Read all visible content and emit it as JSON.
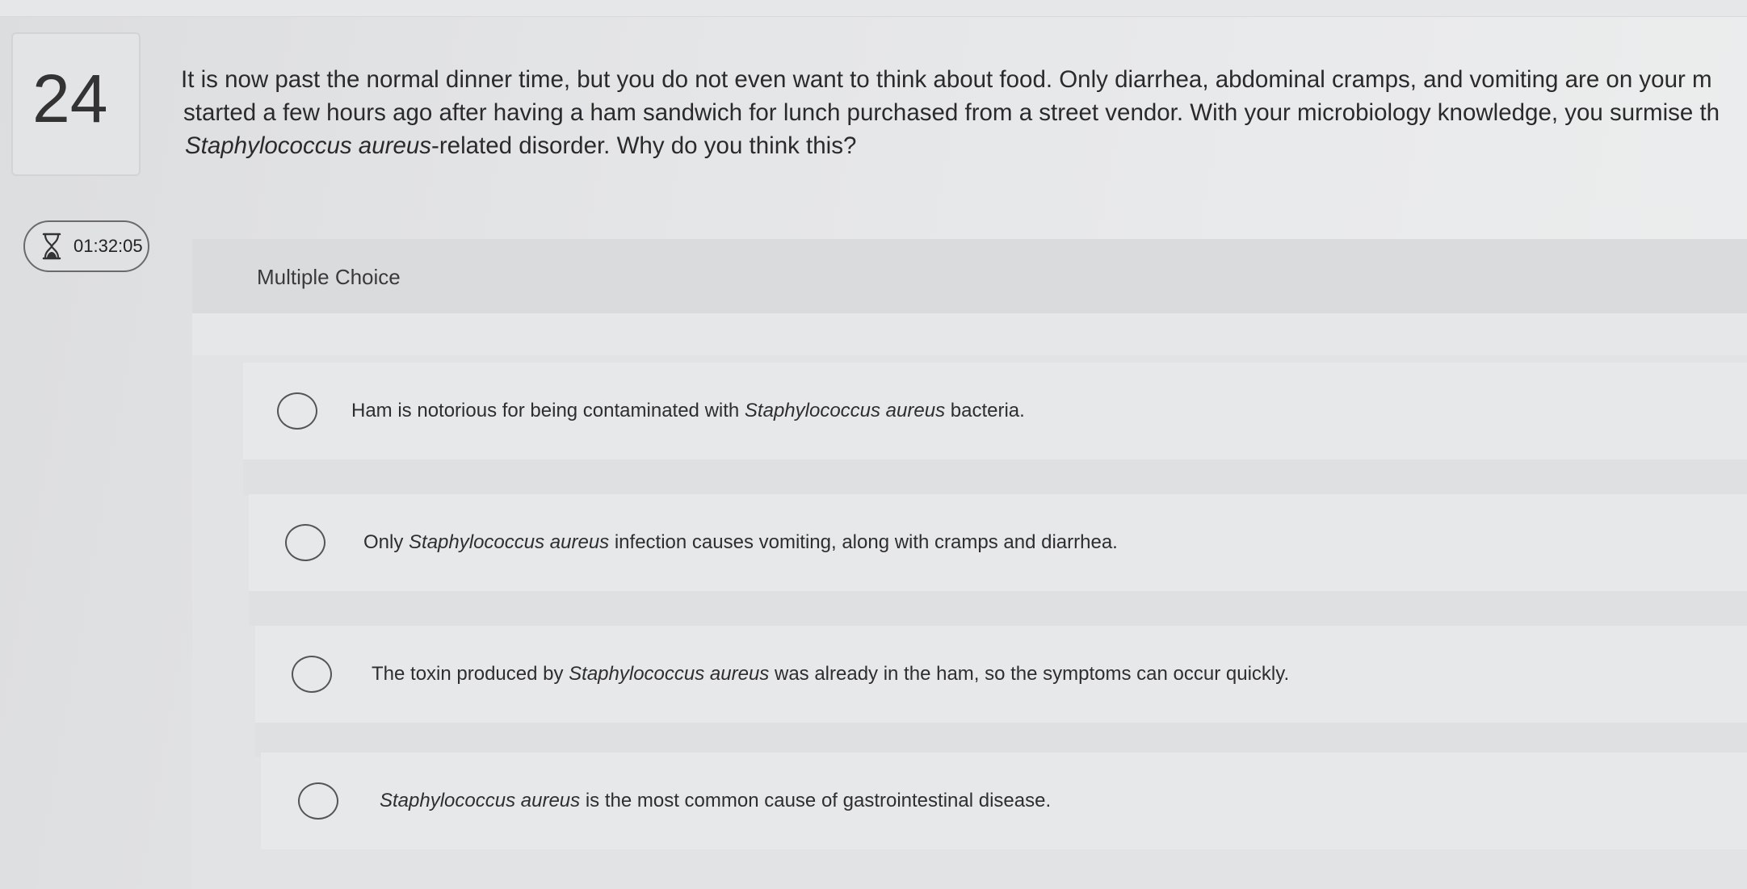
{
  "question": {
    "number": "24",
    "line1": "It is now past the normal dinner time, but you do not even want to think about food. Only diarrhea, abdominal cramps, and vomiting are on your m",
    "line2": "started a few hours ago after having a ham sandwich for lunch purchased from a street vendor. With your microbiology knowledge, you surmise th",
    "line3_italic": "Staphylococcus aureus",
    "line3_rest": "-related disorder. Why do you think this?"
  },
  "timer": {
    "icon": "hourglass-icon",
    "time": "01:32:05"
  },
  "panel": {
    "type_label": "Multiple Choice"
  },
  "choices": [
    {
      "before": "Ham is notorious for being contaminated with ",
      "italic": "Staphylococcus aureus",
      "after": " bacteria."
    },
    {
      "before": "Only ",
      "italic": "Staphylococcus aureus",
      "after": " infection causes vomiting, along with cramps and diarrhea."
    },
    {
      "before": "The toxin produced by ",
      "italic": "Staphylococcus aureus",
      "after": " was already in the ham, so the symptoms can occur quickly."
    },
    {
      "before": "",
      "italic": "Staphylococcus aureus",
      "after": " is the most common cause of gastrointestinal disease."
    }
  ]
}
